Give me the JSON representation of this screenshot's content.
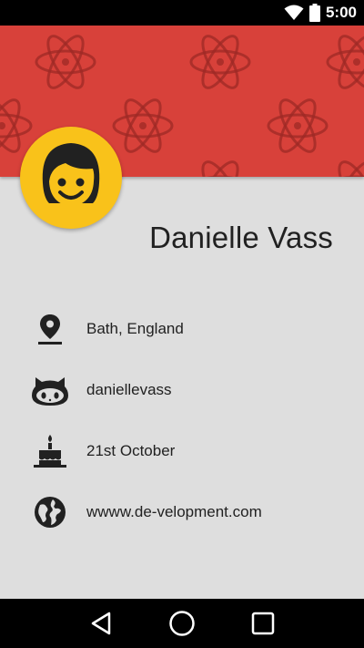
{
  "status_bar": {
    "time": "5:00",
    "icons": [
      "wifi-icon",
      "battery-icon"
    ]
  },
  "header": {
    "background_color": "#d8413a",
    "pattern_icon": "atom-icon"
  },
  "profile": {
    "avatar_icon": "child-face-icon",
    "avatar_color": "#f9c21a",
    "name": "Danielle Vass"
  },
  "info": [
    {
      "icon": "location-pin-icon",
      "text": "Bath, England"
    },
    {
      "icon": "github-octocat-icon",
      "text": "daniellevass"
    },
    {
      "icon": "birthday-cake-icon",
      "text": "21st October"
    },
    {
      "icon": "globe-icon",
      "text": "wwww.de-velopment.com"
    }
  ],
  "nav_bar": {
    "buttons": [
      "back-button",
      "home-button",
      "recents-button"
    ]
  }
}
